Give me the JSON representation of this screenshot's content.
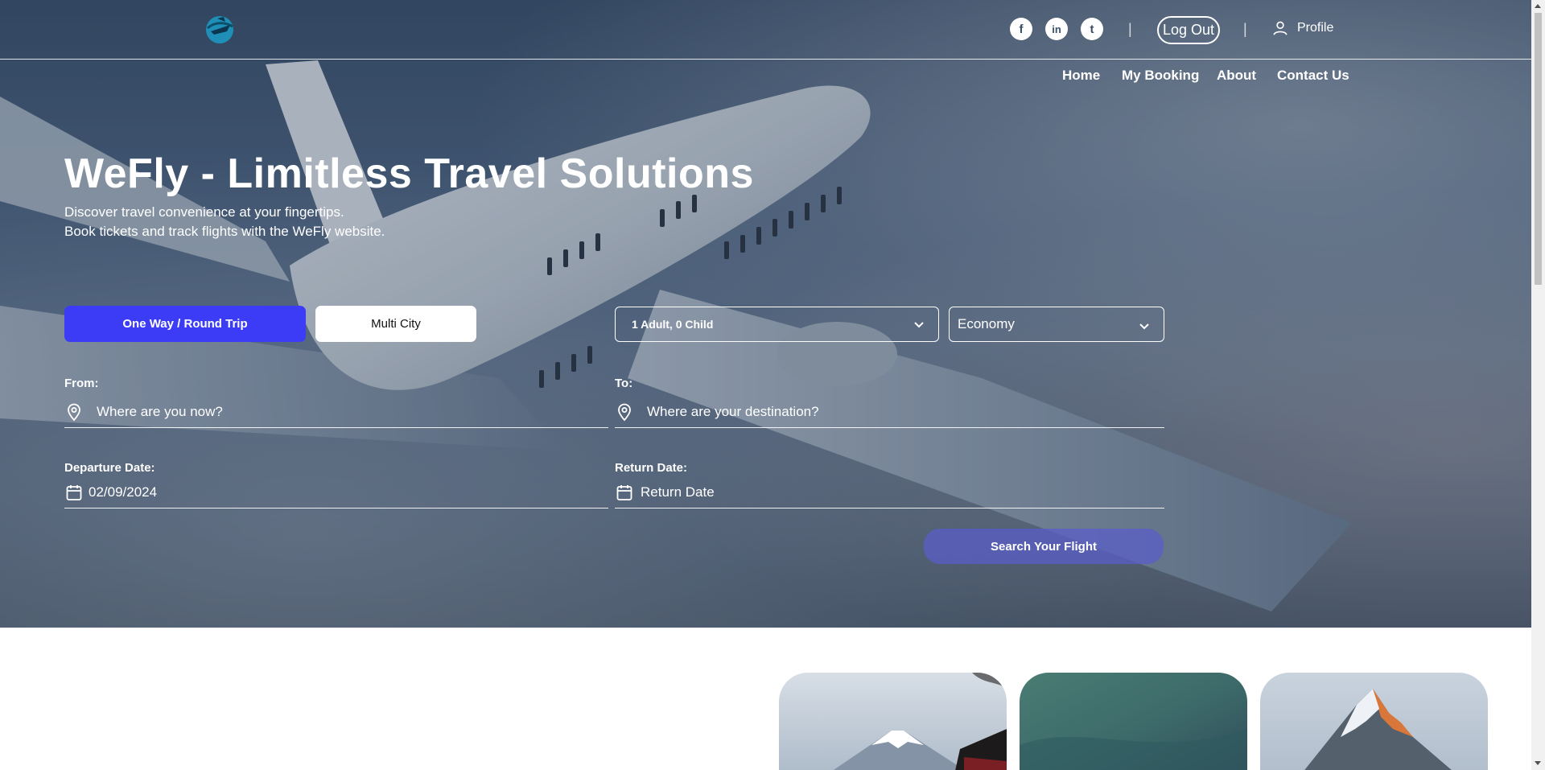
{
  "brand": {
    "logo_icon": "airplane-globe-logo"
  },
  "header": {
    "social": [
      {
        "name": "facebook-icon",
        "glyph": "f"
      },
      {
        "name": "linkedin-icon",
        "glyph": "in"
      },
      {
        "name": "twitter-icon",
        "glyph": "t"
      }
    ],
    "separator": "|",
    "logout_label": "Log Out",
    "profile_label": "Profile"
  },
  "nav": {
    "items": [
      "Home",
      "My Booking",
      "About",
      "Contact Us"
    ]
  },
  "hero": {
    "title": "WeFly - Limitless Travel Solutions",
    "subtitle_line1": "Discover travel convenience at your fingertips.",
    "subtitle_line2": "Book tickets and track flights with the WeFly website."
  },
  "booking": {
    "trip_types": {
      "one_way_round": "One Way / Round Trip",
      "multi_city": "Multi City"
    },
    "passengers": "1 Adult, 0 Child",
    "cabin_class": "Economy",
    "from_label": "From:",
    "from_placeholder": "Where are you now?",
    "to_label": "To:",
    "to_placeholder": "Where are your destination?",
    "departure_label": "Departure Date:",
    "departure_value": "02/09/2024",
    "return_label": "Return Date:",
    "return_placeholder": "Return Date",
    "search_label": "Search Your Flight"
  },
  "colors": {
    "primary": "#3c3cf7",
    "search_button": "#5a5fc8"
  },
  "destinations": [
    {
      "name": "destination-card-mount-fuji"
    },
    {
      "name": "destination-card-aurora"
    },
    {
      "name": "destination-card-mountain-peak"
    }
  ]
}
